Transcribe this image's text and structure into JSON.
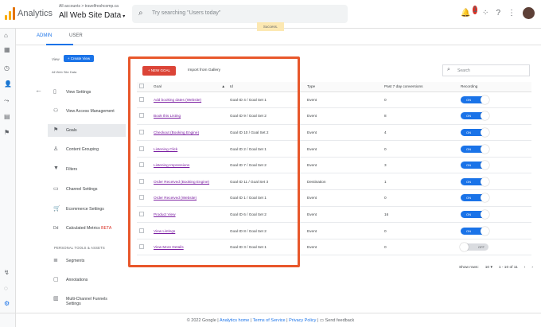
{
  "app": {
    "title": "Analytics",
    "account_path": "All accounts > travelfreshcomp.ca",
    "view_name": "All Web Site Data"
  },
  "search": {
    "placeholder": "Try searching \"Users today\""
  },
  "tooltip": "Success.",
  "notifications": {
    "count": "1"
  },
  "tabs": {
    "admin": "ADMIN",
    "user": "USER"
  },
  "sidebar": {
    "view_label": "View",
    "create_view": "+ Create View",
    "view_name": "All Web Site Data",
    "items": [
      {
        "label": "View Settings",
        "icon": "page-icon"
      },
      {
        "label": "View Access Management",
        "icon": "people-icon"
      },
      {
        "label": "Goals",
        "icon": "flag-icon"
      },
      {
        "label": "Content Grouping",
        "icon": "person-icon"
      },
      {
        "label": "Filters",
        "icon": "filter-icon"
      },
      {
        "label": "Channel Settings",
        "icon": "channel-icon"
      },
      {
        "label": "Ecommerce Settings",
        "icon": "cart-icon"
      },
      {
        "label": "Calculated Metrics",
        "beta": "BETA",
        "icon": "dd-icon"
      }
    ],
    "section_header": "PERSONAL TOOLS & ASSETS",
    "tools": [
      {
        "label": "Segments",
        "icon": "segment-icon"
      },
      {
        "label": "Annotations",
        "icon": "annotation-icon"
      },
      {
        "label1": "Multi-Channel Funnels",
        "label2": "Settings",
        "icon": "chart-icon"
      }
    ]
  },
  "toolbar": {
    "new_goal": "+ NEW GOAL",
    "import": "Import from Gallery",
    "search_placeholder": "Search"
  },
  "table": {
    "headers": [
      "Goal",
      "Id",
      "Type",
      "Past 7 day conversions",
      "Recording"
    ],
    "rows": [
      {
        "goal": "Add booking dates (Website)",
        "id": "Goal ID 4 / Goal Set 1",
        "type": "Event",
        "conv": "0",
        "rec": "ON"
      },
      {
        "goal": "Book this Listing",
        "id": "Goal ID 9 / Goal Set 2",
        "type": "Event",
        "conv": "8",
        "rec": "ON"
      },
      {
        "goal": "Checkout (Booking Engine)",
        "id": "Goal ID 10 / Goal Set 2",
        "type": "Event",
        "conv": "4",
        "rec": "ON"
      },
      {
        "goal": "Listening Click",
        "id": "Goal ID 2 / Goal Set 1",
        "type": "Event",
        "conv": "0",
        "rec": "ON"
      },
      {
        "goal": "Listening Impressions",
        "id": "Goal ID 7 / Goal Set 2",
        "type": "Event",
        "conv": "3",
        "rec": "ON"
      },
      {
        "goal": "Order Received (Booking Engine)",
        "id": "Goal ID 11 / Goal Set 3",
        "type": "Destination",
        "conv": "1",
        "rec": "ON"
      },
      {
        "goal": "Order Received (Website)",
        "id": "Goal ID 1 / Goal Set 1",
        "type": "Event",
        "conv": "0",
        "rec": "ON"
      },
      {
        "goal": "Product View",
        "id": "Goal ID 6 / Goal Set 2",
        "type": "Event",
        "conv": "16",
        "rec": "ON"
      },
      {
        "goal": "View Listings",
        "id": "Goal ID 8 / Goal Set 2",
        "type": "Event",
        "conv": "0",
        "rec": "ON"
      },
      {
        "goal": "View More Details",
        "id": "Goal ID 3 / Goal Set 1",
        "type": "Event",
        "conv": "0",
        "rec": "OFF"
      }
    ]
  },
  "pager": {
    "show_rows_label": "Show rows:",
    "rows_value": "10",
    "range": "1 - 10 of 11"
  },
  "footer": {
    "copyright": "© 2022 Google",
    "analytics_home": "Analytics home",
    "terms": "Terms of Service",
    "privacy": "Privacy Policy",
    "feedback": "Send feedback"
  },
  "colors": {
    "accent": "#1a73e8",
    "new_goal": "#db4437",
    "highlight": "#e8572b"
  }
}
